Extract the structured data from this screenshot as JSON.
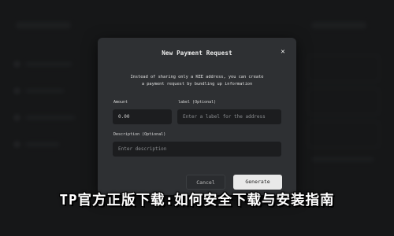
{
  "modal": {
    "title": "New Payment Request",
    "description_line1": "Instead of sharing only a KEE address, you can create",
    "description_line2": "a payment request by bundling up information",
    "amount_label": "Amount",
    "amount_value": "0.00",
    "label_label": "label (Optional)",
    "label_placeholder": "Enter a label for the address",
    "description_label": "Description (Optional)",
    "description_placeholder": "Enter description",
    "cancel_label": "Cancel",
    "generate_label": "Generate",
    "close_icon": "close-icon"
  },
  "headline": "TP官方正版下载:如何安全下载与安装指南",
  "colors": {
    "modal_bg": "#2e3033",
    "field_bg": "#1c1d1f",
    "generate_bg": "#e9e9e9"
  }
}
